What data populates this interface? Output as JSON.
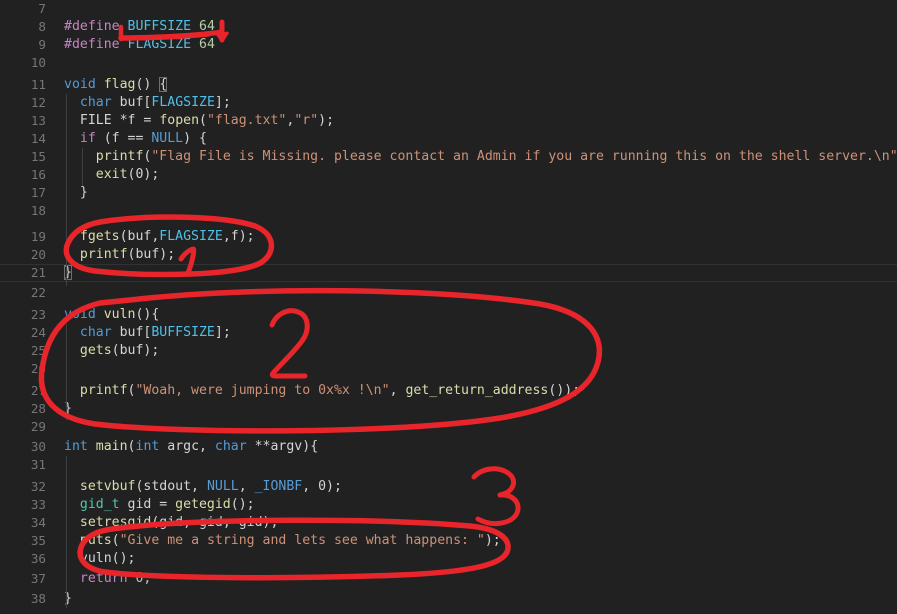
{
  "app": {
    "kind": "code-editor",
    "language": "C",
    "theme": "dark",
    "background_color": "#212121",
    "marker_color": "#e8252b"
  },
  "editor": {
    "first_line": 7,
    "last_line": 38,
    "lines": [
      {
        "n": "7",
        "text": ""
      },
      {
        "n": "8",
        "text": "#define BUFFSIZE 64"
      },
      {
        "n": "9",
        "text": "#define FLAGSIZE 64"
      },
      {
        "n": "10",
        "text": ""
      },
      {
        "n": "11",
        "text": "void flag() {"
      },
      {
        "n": "12",
        "text": "  char buf[FLAGSIZE];"
      },
      {
        "n": "13",
        "text": "  FILE *f = fopen(\"flag.txt\",\"r\");"
      },
      {
        "n": "14",
        "text": "  if (f == NULL) {"
      },
      {
        "n": "15",
        "text": "    printf(\"Flag File is Missing. please contact an Admin if you are running this on the shell server.\\n\");"
      },
      {
        "n": "16",
        "text": "    exit(0);"
      },
      {
        "n": "17",
        "text": "  }"
      },
      {
        "n": "18",
        "text": ""
      },
      {
        "n": "19",
        "text": "  fgets(buf,FLAGSIZE,f);"
      },
      {
        "n": "20",
        "text": "  printf(buf);"
      },
      {
        "n": "21",
        "text": "}"
      },
      {
        "n": "22",
        "text": ""
      },
      {
        "n": "23",
        "text": "void vuln(){"
      },
      {
        "n": "24",
        "text": "  char buf[BUFFSIZE];"
      },
      {
        "n": "25",
        "text": "  gets(buf);"
      },
      {
        "n": "26",
        "text": ""
      },
      {
        "n": "27",
        "text": "  printf(\"Woah, were jumping to 0x%x !\\n\", get_return_address());"
      },
      {
        "n": "28",
        "text": "}"
      },
      {
        "n": "29",
        "text": ""
      },
      {
        "n": "30",
        "text": "int main(int argc, char **argv){"
      },
      {
        "n": "31",
        "text": ""
      },
      {
        "n": "32",
        "text": "  setvbuf(stdout, NULL, _IONBF, 0);"
      },
      {
        "n": "33",
        "text": "  gid_t gid = getegid();"
      },
      {
        "n": "34",
        "text": "  setresgid(gid, gid, gid);"
      },
      {
        "n": "35",
        "text": "  puts(\"Give me a string and lets see what happens: \");"
      },
      {
        "n": "36",
        "text": "  vuln();"
      },
      {
        "n": "37",
        "text": "  return 0;"
      },
      {
        "n": "38",
        "text": "}"
      }
    ],
    "current_line": "21",
    "bracket_match_lines": [
      "11",
      "21"
    ]
  },
  "line_numbers": {
    "l7": "7",
    "l8": "8",
    "l9": "9",
    "l10": "10",
    "l11": "11",
    "l12": "12",
    "l13": "13",
    "l14": "14",
    "l15": "15",
    "l16": "16",
    "l17": "17",
    "l18": "18",
    "l19": "19",
    "l20": "20",
    "l21": "21",
    "l22": "22",
    "l23": "23",
    "l24": "24",
    "l25": "25",
    "l26": "26",
    "l27": "27",
    "l28": "28",
    "l29": "29",
    "l30": "30",
    "l31": "31",
    "l32": "32",
    "l33": "33",
    "l34": "34",
    "l35": "35",
    "l36": "36",
    "l37": "37",
    "l38": "38"
  },
  "tokens": {
    "define": "#define",
    "buffsize": "BUFFSIZE",
    "flagsize": "FLAGSIZE",
    "sixtyfour": "64",
    "void": "void",
    "flag_name": "flag",
    "paren_open_brace": "() {",
    "char": "char",
    "buf_flagsize": "buf[FLAGSIZE];",
    "file": "FILE",
    "f_assign": "*f = ",
    "fopen": "fopen",
    "fopen_args_open": "(",
    "flag_txt": "\"flag.txt\"",
    "comma": ",",
    "r_mode": "\"r\"",
    "close_semi": ");",
    "if": "if",
    "f_eq": " (f == ",
    "null": "NULL",
    "close_brace_open": ") {",
    "printf": "printf",
    "missing_str": "\"Flag File is Missing. please contact an Admin if you are running this on the shell server.\\n\"",
    "exit": "exit",
    "zero_args": "(0);",
    "rbrace": "}",
    "fgets": "fgets",
    "fgets_args_a": "(buf,",
    "fgets_args_b": ",f);",
    "printf_buf": "(buf);",
    "vuln_name": "vuln",
    "vuln_sig": "(){",
    "buf_buffsize": "buf[BUFFSIZE];",
    "gets": "gets",
    "woah_str": "\"Woah, were jumping to 0x%x !\\n\"",
    "comma_space": ", ",
    "get_return_address": "get_return_address",
    "gra_call": "());",
    "int": "int",
    "main_name": "main",
    "main_open": "(",
    "argc": " argc, ",
    "argv": " **argv){",
    "setvbuf": "setvbuf",
    "stdout_open": "(stdout, ",
    "ionbf": "_IONBF",
    "zero_end": ", 0);",
    "gid_t": "gid_t",
    "gid_assign": " gid = ",
    "getegid": "getegid",
    "empty_call": "();",
    "setresgid": "setresgid",
    "setresgid_args": "(gid, gid, gid);",
    "puts": "puts",
    "give_me_str": "\"Give me a string and lets see what happens: \"",
    "vuln_call": "();",
    "return": "return",
    "zero": " 0;"
  },
  "annotations": {
    "color": "#e8252b",
    "marks": [
      {
        "id": "underline-buffsize",
        "kind": "underline-with-arrow",
        "target": "#define BUFFSIZE 64",
        "label": ""
      },
      {
        "id": "circle-1",
        "kind": "ellipse",
        "target": "fgets(buf,FLAGSIZE,f); printf(buf);",
        "label": "1"
      },
      {
        "id": "circle-2",
        "kind": "ellipse",
        "target": "void vuln() { ... }",
        "label": "2"
      },
      {
        "id": "circle-3",
        "kind": "ellipse",
        "target": "puts(\"Give me a string and lets see what happens: \"); vuln();",
        "label": "3"
      }
    ],
    "numeral_1": "1",
    "numeral_2": "2",
    "numeral_3": "3"
  }
}
